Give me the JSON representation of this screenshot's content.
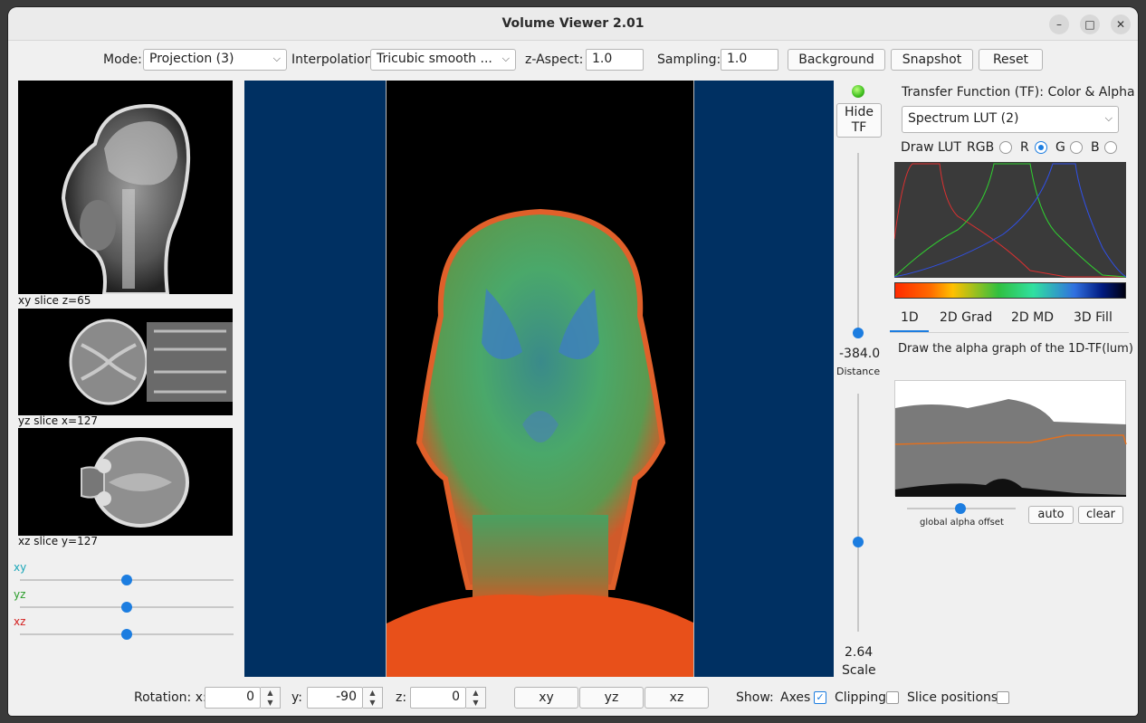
{
  "window": {
    "title": "Volume Viewer 2.01",
    "minimize_glyph": "–",
    "maximize_glyph": "□",
    "close_glyph": "✕"
  },
  "toolbar": {
    "mode_label": "Mode:",
    "mode_value": "Projection (3)",
    "interp_label": "Interpolation:",
    "interp_value": "Tricubic smooth ...",
    "zaspect_label": "z-Aspect:",
    "zaspect_value": "1.0",
    "sampling_label": "Sampling:",
    "sampling_value": "1.0",
    "background_button": "Background",
    "snapshot_button": "Snapshot",
    "reset_button": "Reset"
  },
  "slices": {
    "xy_caption": "xy slice  z=65",
    "yz_caption": "yz slice  x=127",
    "xz_caption": "xz slice  y=127",
    "sliders": [
      {
        "label": "xy",
        "color": "#1aa7b8",
        "value": 0.5
      },
      {
        "label": "yz",
        "color": "#2a9d2a",
        "value": 0.5
      },
      {
        "label": "xz",
        "color": "#d42020",
        "value": 0.5
      }
    ]
  },
  "vertical_controls": {
    "hide_tf_button": "Hide TF",
    "status_led_color": "#3fbf1f",
    "distance_value": "-384.0",
    "distance_label": "Distance",
    "scale_value": "2.64",
    "scale_label": "Scale"
  },
  "tf_panel": {
    "heading": "Transfer Function (TF): Color & Alpha",
    "lut_value": "Spectrum LUT (2)",
    "draw_lut_label": "Draw LUT",
    "channels": [
      {
        "label": "RGB",
        "selected": false
      },
      {
        "label": "R",
        "selected": true
      },
      {
        "label": "G",
        "selected": false
      },
      {
        "label": "B",
        "selected": false
      }
    ],
    "tabs": [
      "1D",
      "2D Grad",
      "2D MD",
      "3D Fill"
    ],
    "active_tab": "1D",
    "alpha_hint": "Draw the alpha graph of the 1D-TF(lum)",
    "global_alpha_label": "global alpha offset",
    "global_alpha_value": 0.25,
    "auto_button": "auto",
    "clear_button": "clear"
  },
  "bottom": {
    "rotation_label": "Rotation: x:",
    "rot_x": "0",
    "y_label": "y:",
    "rot_y": "-90",
    "z_label": "z:",
    "rot_z": "0",
    "view_buttons": [
      "xy",
      "yz",
      "xz"
    ],
    "show_label": "Show:",
    "axes_label": "Axes",
    "axes_checked": true,
    "clipping_label": "Clipping",
    "clipping_checked": false,
    "slice_positions_label": "Slice positions",
    "slice_positions_checked": false
  },
  "colors": {
    "accent": "#1c7de0",
    "viewport_bg": "#003062"
  }
}
